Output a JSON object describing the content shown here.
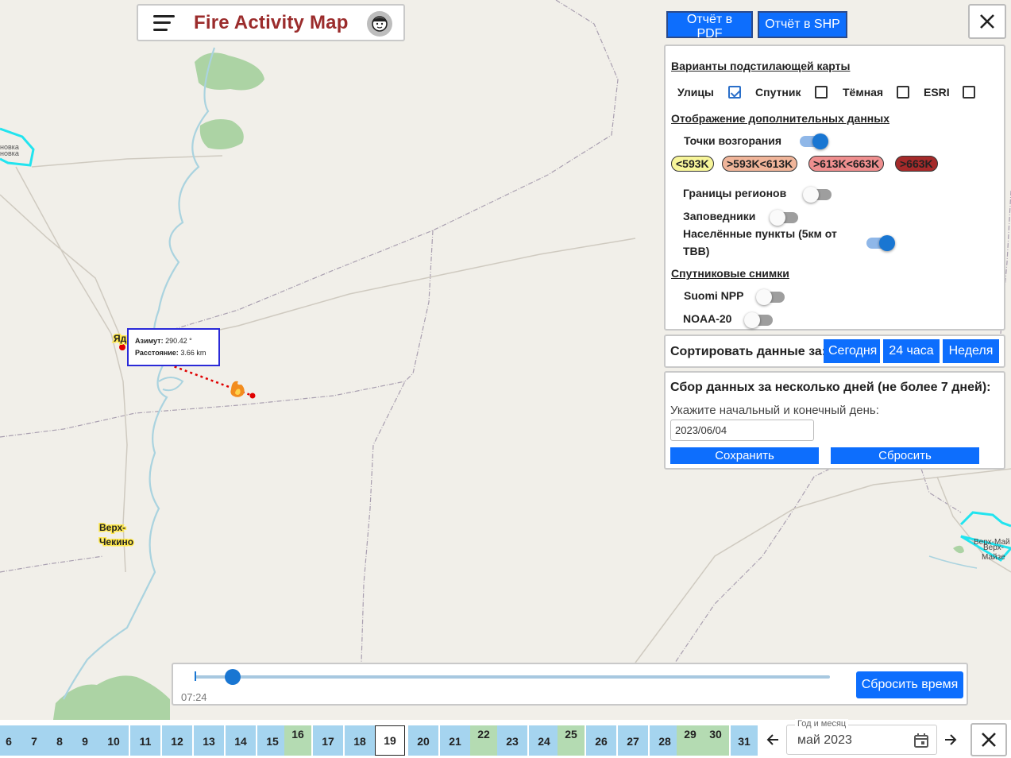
{
  "header": {
    "title": "Fire Activity Map"
  },
  "reports": {
    "pdf": "Отчёт в PDF",
    "shp": "Отчёт в SHP"
  },
  "layers": {
    "basemap_title": "Варианты подстилающей карты",
    "basemaps": [
      {
        "label": "Улицы",
        "checked": true
      },
      {
        "label": "Спутник",
        "checked": false
      },
      {
        "label": "Тёмная",
        "checked": false
      },
      {
        "label": "ESRI",
        "checked": false
      }
    ],
    "extra_title": "Отображение дополнительных данных",
    "hotspots_label": "Точки возгорания",
    "temp_badges": [
      {
        "label": "<593K",
        "color": "#f7f59a"
      },
      {
        "label": ">593K<613K",
        "color": "#f0b59a"
      },
      {
        "label": ">613K<663K",
        "color": "#ef8f8f"
      },
      {
        "label": ">663K",
        "color": "#a52a2a"
      }
    ],
    "regions_label": "Границы регионов",
    "reserves_label": "Заповедники",
    "settlements_label_1": "Населённые пункты (5км от",
    "settlements_label_2": "ТВВ)",
    "sat_title": "Спутниковые снимки",
    "suomi_label": "Suomi NPP",
    "noaa_label": "NOAA-20"
  },
  "sort": {
    "label": "Сортировать данные за:",
    "today": "Сегодня",
    "day": "24 часа",
    "week": "Неделя"
  },
  "collect": {
    "title": "Сбор данных за несколько дней (не более 7 дней):",
    "hint": "Укажите начальный и конечный день:",
    "date_value": "2023/06/04",
    "save": "Сохранить",
    "reset": "Сбросить"
  },
  "measure": {
    "azimuth_label": "Азимут:",
    "azimuth_value": "290.42 °",
    "distance_label": "Расстояние:",
    "distance_value": "3.66 km"
  },
  "map_labels": {
    "village1_a": "Верх-",
    "village1_b": "Чекино",
    "village2_a": "Верх-Май",
    "village2_b": "Верх-",
    "village2_c": "Майзе",
    "left_a": "новка",
    "left_b": "новка",
    "yad": "Яд"
  },
  "timeline": {
    "time": "07:24",
    "reset_time": "Сбросить время",
    "progress": 0.06
  },
  "calendar": {
    "month_label": "Год и месяц",
    "month_value": "май 2023",
    "days": [
      {
        "d": "6",
        "g": false
      },
      {
        "d": "7",
        "g": false
      },
      {
        "d": "8",
        "g": false
      },
      {
        "d": "9",
        "g": false
      },
      {
        "d": "10",
        "g": false
      },
      {
        "d": "11",
        "g": false
      },
      {
        "d": "12",
        "g": false
      },
      {
        "d": "13",
        "g": false
      },
      {
        "d": "14",
        "g": false
      },
      {
        "d": "15",
        "g": false
      },
      {
        "d": "16",
        "g": true
      },
      {
        "d": "17",
        "g": false
      },
      {
        "d": "18",
        "g": false
      },
      {
        "d": "19",
        "g": false,
        "sel": true
      },
      {
        "d": "20",
        "g": false
      },
      {
        "d": "21",
        "g": false
      },
      {
        "d": "22",
        "g": true
      },
      {
        "d": "23",
        "g": false
      },
      {
        "d": "24",
        "g": false
      },
      {
        "d": "25",
        "g": true
      },
      {
        "d": "26",
        "g": false
      },
      {
        "d": "27",
        "g": false
      },
      {
        "d": "28",
        "g": false
      },
      {
        "d": "29",
        "g": true
      },
      {
        "d": "30",
        "g": true
      },
      {
        "d": "31",
        "g": false
      }
    ]
  }
}
